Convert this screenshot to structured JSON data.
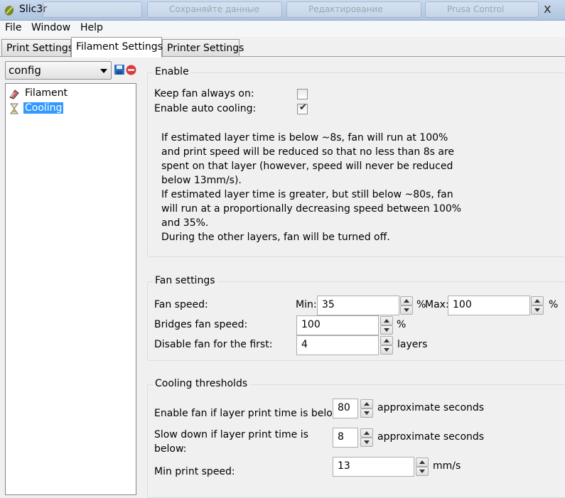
{
  "window": {
    "title": "Slic3r",
    "close_glyph": "x",
    "background_tabs": [
      "",
      "Сохраняйте данные",
      "Редактирование",
      "Prusa Control"
    ]
  },
  "menu": [
    "File",
    "Window",
    "Help"
  ],
  "tabs": [
    {
      "label": "Print Settings",
      "active": false
    },
    {
      "label": "Filament Settings",
      "active": true
    },
    {
      "label": "Printer Settings",
      "active": false
    }
  ],
  "preset": {
    "value": "config"
  },
  "icons": {
    "app": "slic3r-logo-icon",
    "save": "save-icon",
    "delete": "delete-icon",
    "filament": "filament-icon",
    "cooling": "hourglass-icon"
  },
  "tree": [
    {
      "label": "Filament",
      "selected": false
    },
    {
      "label": "Cooling",
      "selected": true
    }
  ],
  "enable_group": {
    "title": "Enable",
    "keep_fan_label": "Keep fan always on:",
    "keep_fan_checked": false,
    "auto_cooling_label": "Enable auto cooling:",
    "auto_cooling_checked": true,
    "description": [
      "If estimated layer time is below ~8s, fan will run at 100%",
      "and print speed will be reduced so that no less than 8s are",
      "spent on that layer (however, speed will never be reduced",
      "below 13mm/s).",
      "If estimated layer time is greater, but still below ~80s, fan",
      "will run at a proportionally decreasing speed between 100%",
      "and 35%.",
      "During the other layers, fan will be turned off."
    ]
  },
  "fan_group": {
    "title": "Fan settings",
    "fan_speed_label": "Fan speed:",
    "min_label": "Min:",
    "min_value": "35",
    "min_unit": "%",
    "max_label": "Max:",
    "max_value": "100",
    "max_unit": "%",
    "bridges_label": "Bridges fan speed:",
    "bridges_value": "100",
    "bridges_unit": "%",
    "disable_first_label": "Disable fan for the first:",
    "disable_first_value": "4",
    "disable_first_unit": "layers"
  },
  "cooling_group": {
    "title": "Cooling thresholds",
    "enable_below_label": "Enable fan if layer print time is below:",
    "enable_below_value": "80",
    "enable_below_unit": "approximate seconds",
    "slow_down_label_1": "Slow down if layer print time is",
    "slow_down_label_2": "below:",
    "slow_down_value": "8",
    "slow_down_unit": "approximate seconds",
    "min_speed_label": "Min print speed:",
    "min_speed_value": "13",
    "min_speed_unit": "mm/s"
  },
  "colors": {
    "selection": "#3399ff",
    "titlebar": "#b9cde6",
    "window_bg": "#f0f0f0"
  }
}
